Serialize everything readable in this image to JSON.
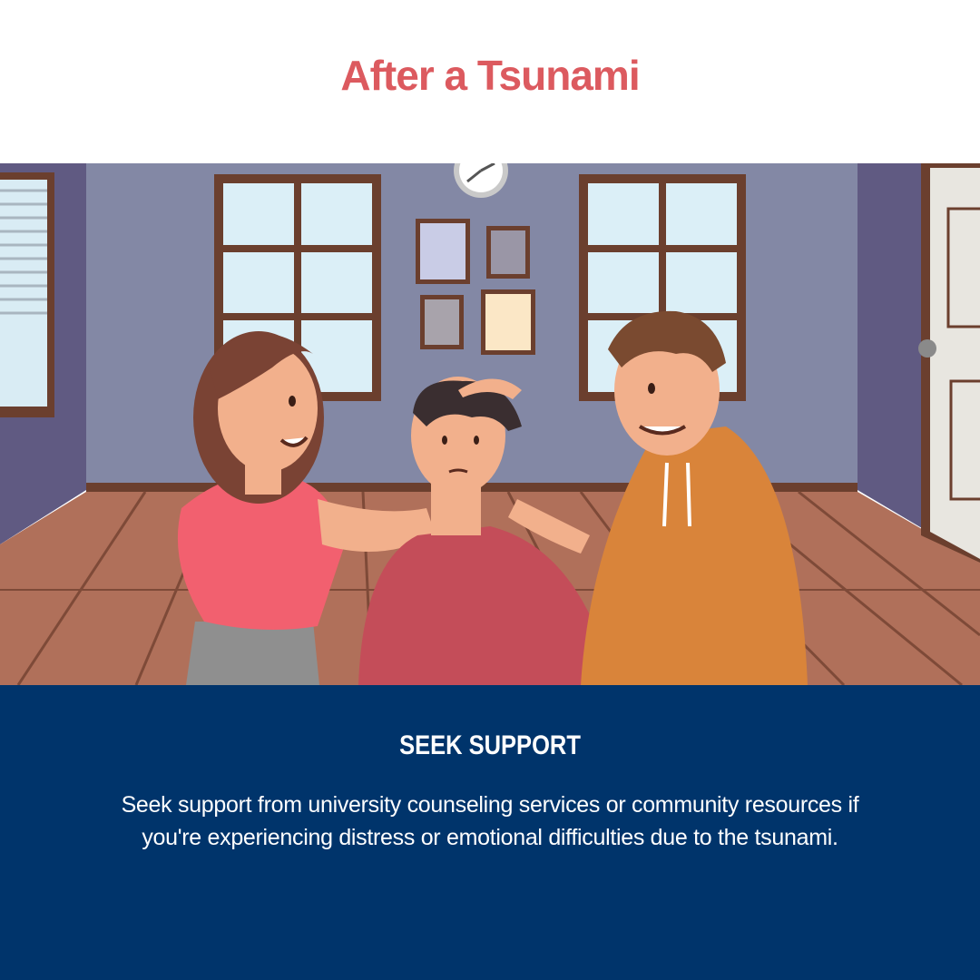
{
  "header": {
    "title": "After a Tsunami"
  },
  "illustration": {
    "subject": "room-with-three-people-comforting"
  },
  "panel": {
    "heading": "SEEK SUPPORT",
    "body": "Seek support from university counseling services or community resources if you're experiencing distress or emotional difficulties due to the tsunami."
  },
  "colors": {
    "title": "#dc5a5f",
    "panel_background": "#00346b",
    "panel_text": "#ffffff"
  }
}
